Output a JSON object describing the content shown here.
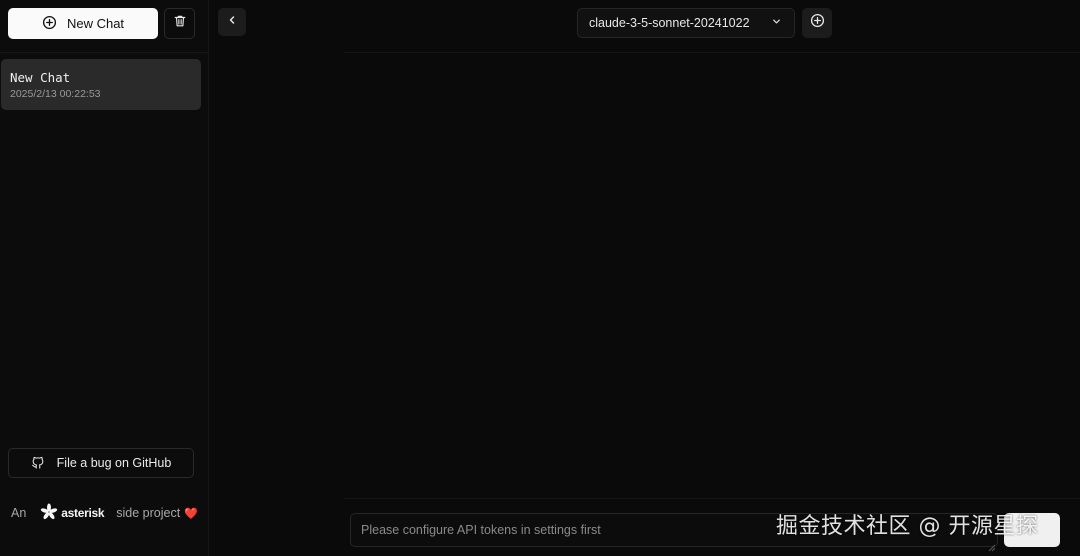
{
  "sidebar": {
    "new_chat_label": "New Chat",
    "chats": [
      {
        "title": "New Chat",
        "timestamp": "2025/2/13 00:22:53"
      }
    ],
    "bug_report_label": "File a bug on GitHub",
    "footer": {
      "prefix": "An",
      "brand": "asterisk",
      "suffix": "side project",
      "heart": "❤️"
    }
  },
  "header": {
    "model": "claude-3-5-sonnet-20241022"
  },
  "composer": {
    "placeholder": "Please configure API tokens in settings first",
    "value": ""
  },
  "watermark": "掘金技术社区 @ 开源星探",
  "colors": {
    "background": "#0a0a0a",
    "sidebar": "#0c0c0c",
    "selected_chat": "#2a2a2a",
    "primary_button": "#fafafa",
    "heart": "#e5484d"
  },
  "icons": {
    "new_chat": "plus-circle-icon",
    "trash": "trash-icon",
    "collapse": "chevron-left-icon",
    "model_dropdown": "chevron-down-icon",
    "add": "plus-circle-icon",
    "github": "github-icon",
    "brand": "asterisk-logo"
  }
}
